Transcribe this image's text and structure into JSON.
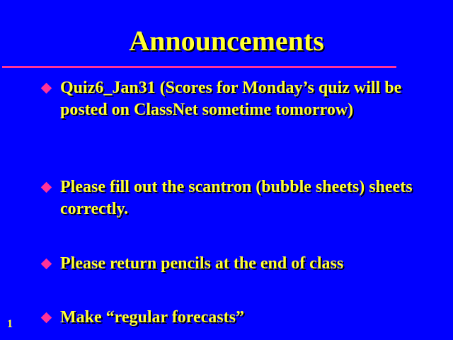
{
  "slide": {
    "title": "Announcements",
    "bullets": [
      "Quiz6_Jan31 (Scores for Monday’s quiz will be posted on ClassNet sometime tomorrow)",
      "Please fill out the scantron (bubble sheets) sheets correctly.",
      "Please return pencils at the end of class",
      "Make “regular forecasts”"
    ],
    "slide_number": "1"
  },
  "colors": {
    "background": "#0000FF",
    "text": "#FFFF33",
    "accent": "#FF3399"
  },
  "icons": {
    "bullet": "diamond-bullet-icon"
  }
}
